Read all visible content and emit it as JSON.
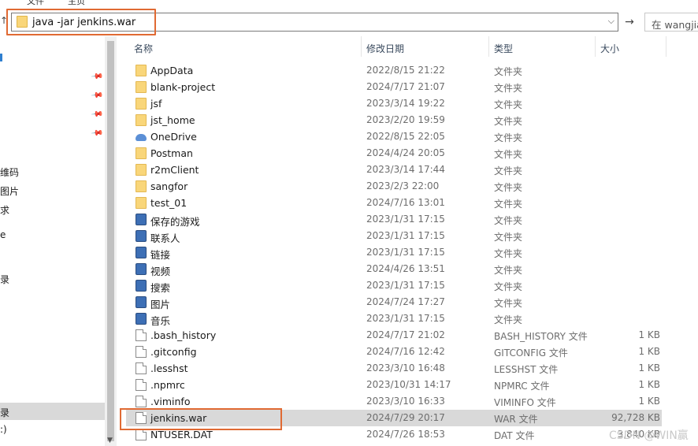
{
  "top_strip": {
    "labels": [
      "文件",
      "主页"
    ]
  },
  "address_bar": {
    "path": "java -jar jenkins.war"
  },
  "search": {
    "placeholder": "在 wangjia"
  },
  "nav_pane": {
    "items": [
      "维码",
      "图片",
      "求",
      "e",
      "录",
      ":)",
      "sk (D:)"
    ]
  },
  "columns": {
    "name": "名称",
    "date": "修改日期",
    "type": "类型",
    "size": "大小"
  },
  "files": [
    {
      "name": "AppData",
      "date": "2022/8/15 21:22",
      "type": "文件夹",
      "size": "",
      "icon": "folder-icon"
    },
    {
      "name": "blank-project",
      "date": "2024/7/17 21:07",
      "type": "文件夹",
      "size": "",
      "icon": "folder-icon"
    },
    {
      "name": "jsf",
      "date": "2023/3/14 19:22",
      "type": "文件夹",
      "size": "",
      "icon": "folder-icon"
    },
    {
      "name": "jst_home",
      "date": "2023/2/20 19:59",
      "type": "文件夹",
      "size": "",
      "icon": "folder-icon"
    },
    {
      "name": "OneDrive",
      "date": "2022/8/15 22:05",
      "type": "文件夹",
      "size": "",
      "icon": "cloud-icon"
    },
    {
      "name": "Postman",
      "date": "2024/4/24 20:05",
      "type": "文件夹",
      "size": "",
      "icon": "folder-icon"
    },
    {
      "name": "r2mClient",
      "date": "2023/3/14 17:44",
      "type": "文件夹",
      "size": "",
      "icon": "folder-icon"
    },
    {
      "name": "sangfor",
      "date": "2023/2/3 22:00",
      "type": "文件夹",
      "size": "",
      "icon": "folder-icon"
    },
    {
      "name": "test_01",
      "date": "2024/7/16 13:01",
      "type": "文件夹",
      "size": "",
      "icon": "folder-icon"
    },
    {
      "name": "保存的游戏",
      "date": "2023/1/31 17:15",
      "type": "文件夹",
      "size": "",
      "icon": "saved-games-icon"
    },
    {
      "name": "联系人",
      "date": "2023/1/31 17:15",
      "type": "文件夹",
      "size": "",
      "icon": "contacts-icon"
    },
    {
      "name": "链接",
      "date": "2023/1/31 17:15",
      "type": "文件夹",
      "size": "",
      "icon": "links-icon"
    },
    {
      "name": "视频",
      "date": "2024/4/26 13:51",
      "type": "文件夹",
      "size": "",
      "icon": "videos-icon"
    },
    {
      "name": "搜索",
      "date": "2023/1/31 17:15",
      "type": "文件夹",
      "size": "",
      "icon": "searches-icon"
    },
    {
      "name": "图片",
      "date": "2024/7/24 17:27",
      "type": "文件夹",
      "size": "",
      "icon": "pictures-icon"
    },
    {
      "name": "音乐",
      "date": "2023/1/31 17:15",
      "type": "文件夹",
      "size": "",
      "icon": "music-icon"
    },
    {
      "name": ".bash_history",
      "date": "2024/7/17 21:02",
      "type": "BASH_HISTORY 文件",
      "size": "1 KB",
      "icon": "file-icon"
    },
    {
      "name": ".gitconfig",
      "date": "2024/7/16 12:42",
      "type": "GITCONFIG 文件",
      "size": "1 KB",
      "icon": "file-icon"
    },
    {
      "name": ".lesshst",
      "date": "2023/3/10 16:48",
      "type": "LESSHST 文件",
      "size": "1 KB",
      "icon": "file-icon"
    },
    {
      "name": ".npmrc",
      "date": "2023/10/31 14:17",
      "type": "NPMRC 文件",
      "size": "1 KB",
      "icon": "file-icon"
    },
    {
      "name": ".viminfo",
      "date": "2023/3/10 16:33",
      "type": "VIMINFO 文件",
      "size": "1 KB",
      "icon": "file-icon"
    },
    {
      "name": "jenkins.war",
      "date": "2024/7/29 20:17",
      "type": "WAR 文件",
      "size": "92,728 KB",
      "icon": "file-icon"
    },
    {
      "name": "NTUSER.DAT",
      "date": "2024/7/26 18:53",
      "type": "DAT 文件",
      "size": "3,840 KB",
      "icon": "file-icon"
    }
  ],
  "selected_file_index": 21,
  "watermark": "CSDN @WIN赢",
  "colors": {
    "highlight_box": "#e06a33",
    "selected_row": "#d9d9d9",
    "folder": "#f9d67a"
  }
}
